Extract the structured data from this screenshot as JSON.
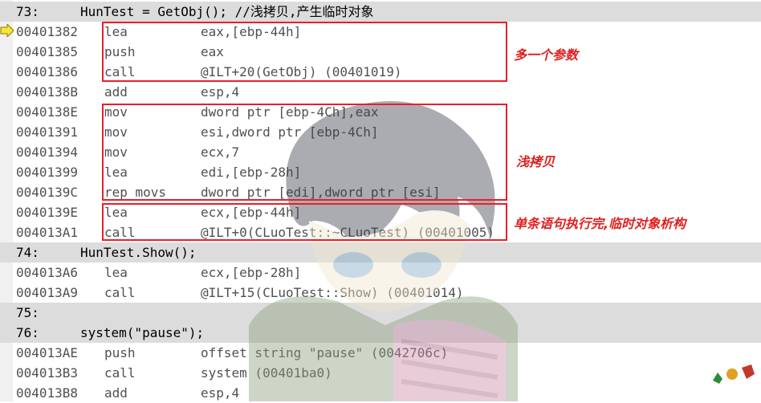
{
  "lines": [
    {
      "type": "src",
      "lineno": "73:",
      "code": "HunTest = GetObj(); //浅拷贝,产生临时对象"
    },
    {
      "type": "asm",
      "addr": "00401382",
      "mnemonic": "lea",
      "operands": "eax,[ebp-44h]"
    },
    {
      "type": "asm",
      "addr": "00401385",
      "mnemonic": "push",
      "operands": "eax"
    },
    {
      "type": "asm",
      "addr": "00401386",
      "mnemonic": "call",
      "operands": "@ILT+20(GetObj) (00401019)"
    },
    {
      "type": "asm",
      "addr": "0040138B",
      "mnemonic": "add",
      "operands": "esp,4"
    },
    {
      "type": "asm",
      "addr": "0040138E",
      "mnemonic": "mov",
      "operands": "dword ptr [ebp-4Ch],eax"
    },
    {
      "type": "asm",
      "addr": "00401391",
      "mnemonic": "mov",
      "operands": "esi,dword ptr [ebp-4Ch]"
    },
    {
      "type": "asm",
      "addr": "00401394",
      "mnemonic": "mov",
      "operands": "ecx,7"
    },
    {
      "type": "asm",
      "addr": "00401399",
      "mnemonic": "lea",
      "operands": "edi,[ebp-28h]"
    },
    {
      "type": "asm",
      "addr": "0040139C",
      "mnemonic": "rep movs",
      "operands": "dword ptr [edi],dword ptr [esi]"
    },
    {
      "type": "asm",
      "addr": "0040139E",
      "mnemonic": "lea",
      "operands": "ecx,[ebp-44h]"
    },
    {
      "type": "asm",
      "addr": "004013A1",
      "mnemonic": "call",
      "operands": "@ILT+0(CLuoTest::~CLuoTest) (00401005)"
    },
    {
      "type": "src",
      "lineno": "74:",
      "code": "HunTest.Show();"
    },
    {
      "type": "asm",
      "addr": "004013A6",
      "mnemonic": "lea",
      "operands": "ecx,[ebp-28h]"
    },
    {
      "type": "asm",
      "addr": "004013A9",
      "mnemonic": "call",
      "operands": "@ILT+15(CLuoTest::Show) (00401014)"
    },
    {
      "type": "src",
      "lineno": "75:",
      "code": ""
    },
    {
      "type": "src",
      "lineno": "76:",
      "code": "system(\"pause\");"
    },
    {
      "type": "asm",
      "addr": "004013AE",
      "mnemonic": "push",
      "operands": "offset string \"pause\" (0042706c)"
    },
    {
      "type": "asm",
      "addr": "004013B3",
      "mnemonic": "call",
      "operands": "system (00401ba0)"
    },
    {
      "type": "asm",
      "addr": "004013B8",
      "mnemonic": "add",
      "operands": "esp,4"
    }
  ],
  "annotations": {
    "extra_param": "多一个参数",
    "shallow_copy": "浅拷贝",
    "temp_destruct": "单条语句执行完,临时对象析构"
  },
  "current_instruction_marker": "arrow-icon",
  "colors": {
    "source_line_bg": "#dcdcdc",
    "highlight_red": "#e8202a",
    "arrow_yellow": "#f5e63a"
  }
}
